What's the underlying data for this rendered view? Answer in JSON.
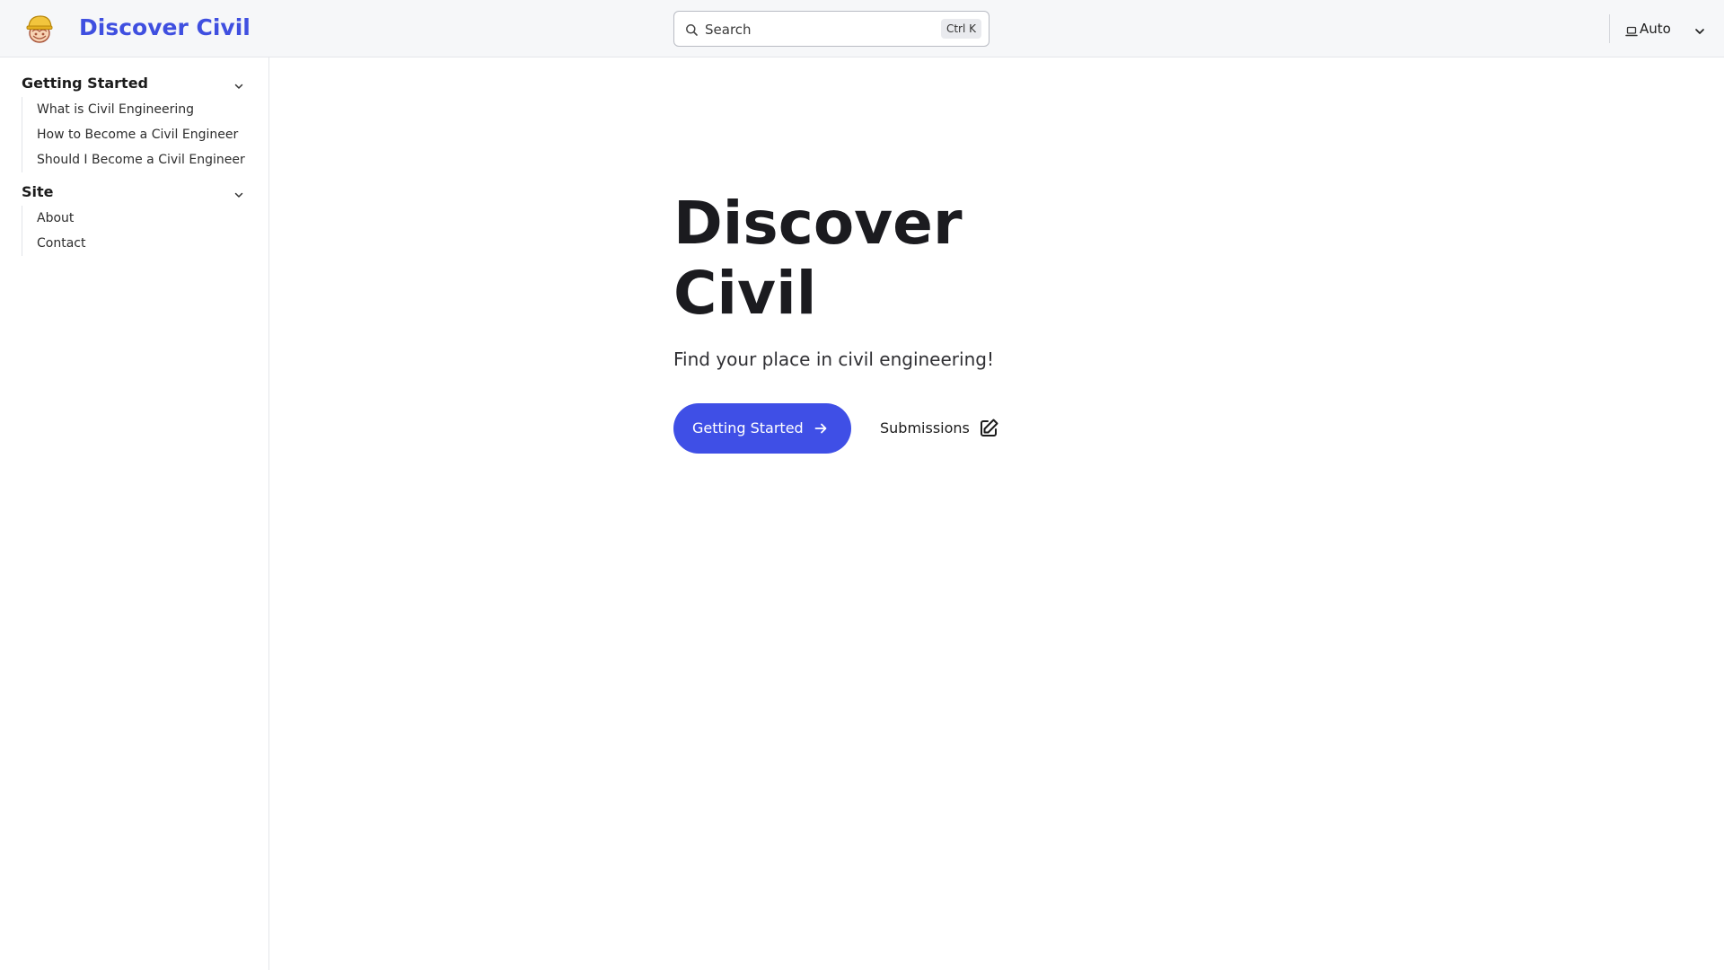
{
  "header": {
    "logo_icon": "hard-hat-character-icon",
    "brand": "Discover Civil",
    "brand_color": "#3f4fe0",
    "search": {
      "placeholder": "Search",
      "shortcut": "Ctrl K",
      "icon": "search-icon"
    },
    "theme": {
      "icon": "laptop-icon",
      "label": "Auto",
      "chevron": "chevron-down-icon"
    }
  },
  "sidebar": {
    "sections": [
      {
        "title": "Getting Started",
        "items": [
          "What is Civil Engineering",
          "How to Become a Civil Engineer",
          "Should I Become a Civil Engineer"
        ]
      },
      {
        "title": "Site",
        "items": [
          "About",
          "Contact"
        ]
      }
    ]
  },
  "hero": {
    "title": "Discover Civil",
    "tagline": "Find your place in civil engineering!",
    "primary_button": {
      "label": "Getting Started",
      "icon": "arrow-right-icon",
      "color": "#3f4fe6"
    },
    "secondary_button": {
      "label": "Submissions",
      "icon": "edit-icon"
    }
  }
}
